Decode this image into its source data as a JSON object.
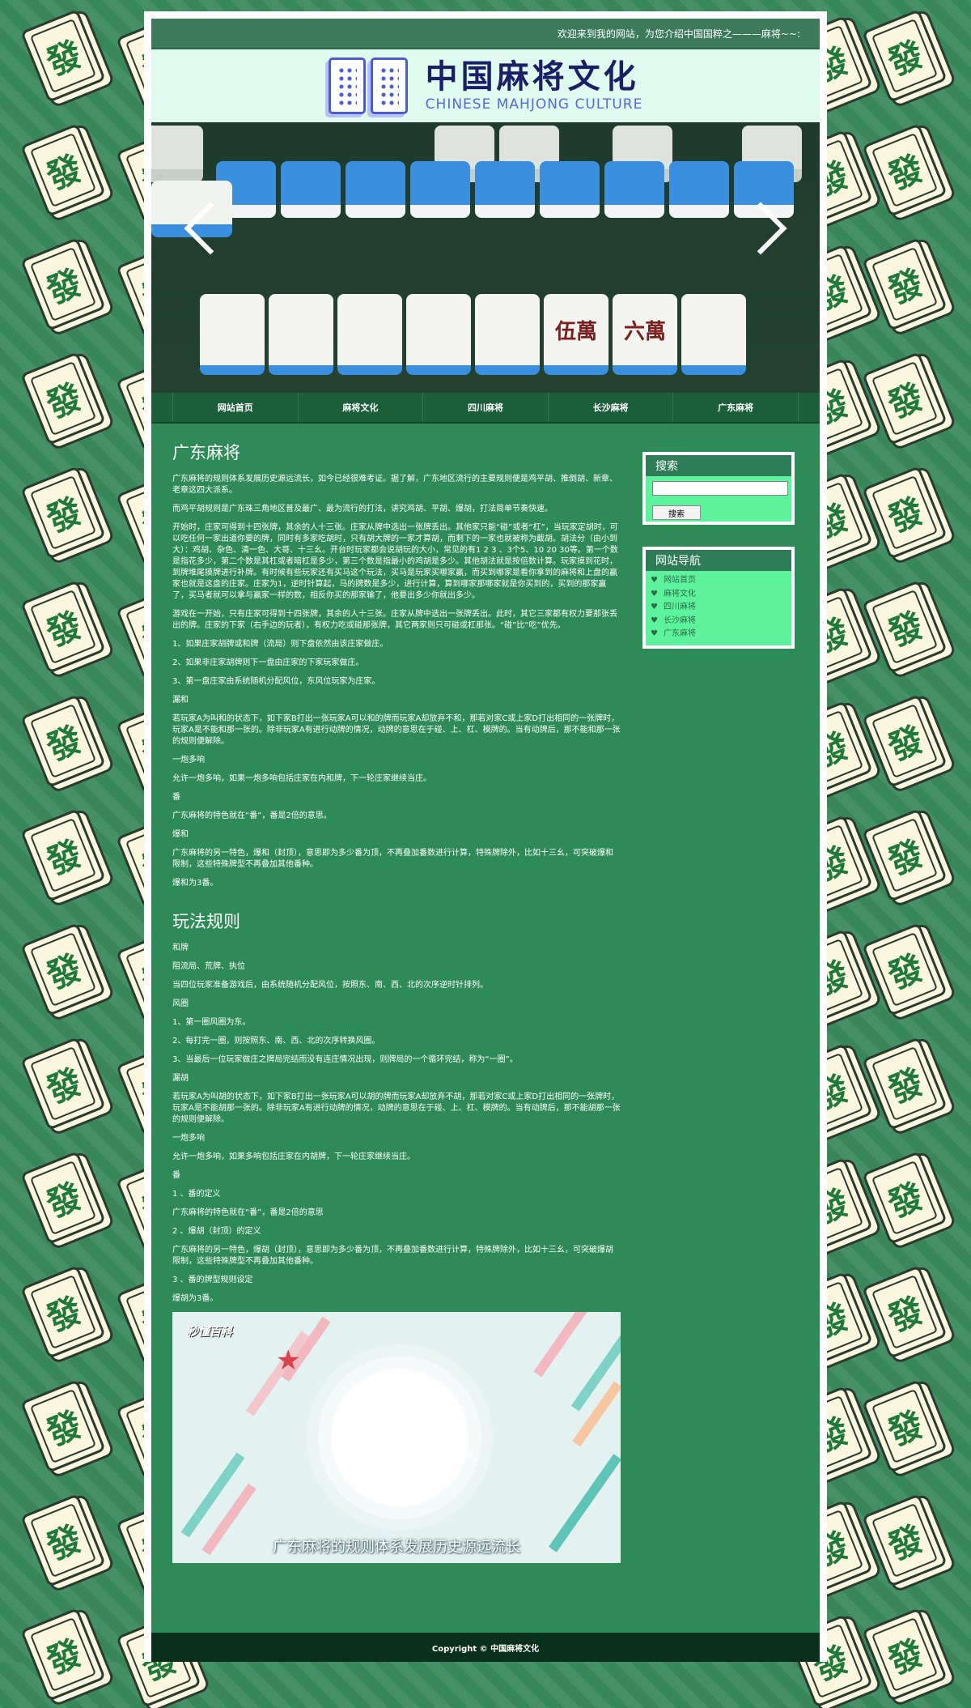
{
  "background": {
    "tile_glyph": "發"
  },
  "topbar": {
    "marquee": "欢迎来到我的网站，为您介绍中国国粹之———麻将~~:"
  },
  "banner": {
    "title_cn": "中国麻将文化",
    "title_en": "CHINESE MAHJONG CULTURE"
  },
  "slider": {
    "tile_faces": [
      "",
      "",
      "",
      "",
      "",
      "伍萬",
      "六萬",
      ""
    ]
  },
  "nav": {
    "items": [
      "网站首页",
      "麻将文化",
      "四川麻将",
      "长沙麻将",
      "广东麻将"
    ]
  },
  "content": {
    "heading1": "广东麻将",
    "section1": [
      "广东麻将的规则体系发展历史源远流长，如今已经很难考证。据了解，广东地区流行的主要规则便是鸡平胡、推倒胡、新章、老章这四大派系。",
      "而鸡平胡规则是广东珠三角地区普及最广、最为流行的打法，讲究鸡胡、平胡、爆胡，打法简单节奏快速。",
      "开始时，庄家可得到十四张牌，其余的人十三张。庄家从牌中选出一张牌丢出。其他家只能“碰”或者“杠”，当玩家定胡时，可以吃任何一家出道你要的牌，同时有多家吃胡时，只有胡大牌的一家才算胡，而剩下的一家也就被称为截胡。胡法分（由小到大）：鸡胡、杂色、清一色、大哥、十三幺。开台时玩家都会说胡玩的大小，常见的有1 2 3 、3个5、10 20 30等。第一个数是指花多少，第二个数是其杠或者暗杠是多少，第三个数是指最小的鸡胡是多少。其他胡法就是按倍数计算。玩家摸到花时，到牌堆尾摸牌进行补牌。有时候有些玩家还有买马这个玩法，买马是玩家买哪家赢，而买到哪家是看你拿到的麻将和上盘的赢家也就是这盘的庄家。庄家为1，逆时针算起，马的牌数是多少，进行计算，算到哪家那哪家就是你买到的，买到的那家赢了，买马者就可以拿与赢家一样的数，相反你买的那家输了，他要出多少你就出多少。",
      "游戏在一开始，只有庄家可得到十四张牌，其余的人十三张。庄家从牌中选出一张牌丢出。此时，其它三家都有权力要那张丢出的牌。庄家的下家（右手边的玩者），有权力吃或碰那张牌，其它两家则只可碰或杠那张。“碰”比“吃”优先。",
      "1、如果庄家胡牌或和牌（流局）则下盘依然由该庄家做庄。",
      "2、如果非庄家胡牌则下一盘由庄家的下家玩家做庄。",
      "3、第一盘庄家由系统随机分配风位，东风位玩家为庄家。",
      "漏和",
      "若玩家A为叫和的状态下，如下家B打出一张玩家A可以和的牌而玩家A却放弃不和，那若对家C或上家D打出相同的一张牌时，玩家A是不能和那一张的。除非玩家A有进行动牌的情况，动牌的意思在于碰、上、杠、模牌的。当有动牌后，那不能和那一张的规则便解除。",
      "一炮多响",
      "允许一炮多响，如果一炮多响包括庄家在内和牌，下一轮庄家继续当庄。",
      "番",
      "广东麻将的特色就在“番”，番是2倍的意思。",
      "爆和",
      "广东麻将的另一特色，爆和（封顶），意思即为多少番为顶，不再叠加番数进行计算，特殊牌除外，比如十三幺，可突破爆和限制，这些特殊牌型不再叠加其他番种。",
      "爆和为3番。"
    ],
    "heading2": "玩法规则",
    "section2": [
      "和牌",
      "阻流局、荒牌、执位",
      "当四位玩家准备游戏后，由系统随机分配风位，按照东、南、西、北的次序逆时针排列。",
      "风圈",
      "1、第一圈风圈为东。",
      "2、每打完一圈，则按照东、南、西、北的次序转换风圈。",
      "3、当最后一位玩家做庄之牌局完结而没有连庄情况出现，则牌局的一个循环完结，称为“一圈”。",
      "漏胡",
      "若玩家A为叫胡的状态下，如下家B打出一张玩家A可以胡的牌而玩家A却放弃不胡，那若对家C或上家D打出相同的一张牌时，玩家A是不能胡那一张的。除非玩家A有进行动牌的情况，动牌的意思在于碰、上、杠、模牌的。当有动牌后，那不能胡那一张的规则便解除。",
      "一炮多响",
      "允许一炮多响，如果多响包括庄家在内胡牌，下一轮庄家继续当庄。",
      "番",
      "1 、番的定义",
      "广东麻将的特色就在“番”，番是2倍的意思",
      "2 、爆胡（封顶）的定义",
      "广东麻将的另一特色，爆胡（封顶），意思即为多少番为顶，不再叠加番数进行计算，特殊牌除外，比如十三幺，可突破爆胡限制，这些特殊牌型不再叠加其他番种。",
      "3 、番的牌型规则设定",
      "爆胡为3番。"
    ],
    "video": {
      "logo": "秒懂百科",
      "caption": "广东麻将的规则体系发展历史源远流长"
    }
  },
  "sidebar": {
    "search": {
      "title": "搜索",
      "input_value": "",
      "button_label": "搜索"
    },
    "sitenav": {
      "title": "网站导航",
      "items": [
        "网站首页",
        "麻将文化",
        "四川麻将",
        "长沙麻将",
        "广东麻将"
      ]
    }
  },
  "footer": {
    "copyright": "Copyright © 中国麻将文化"
  }
}
